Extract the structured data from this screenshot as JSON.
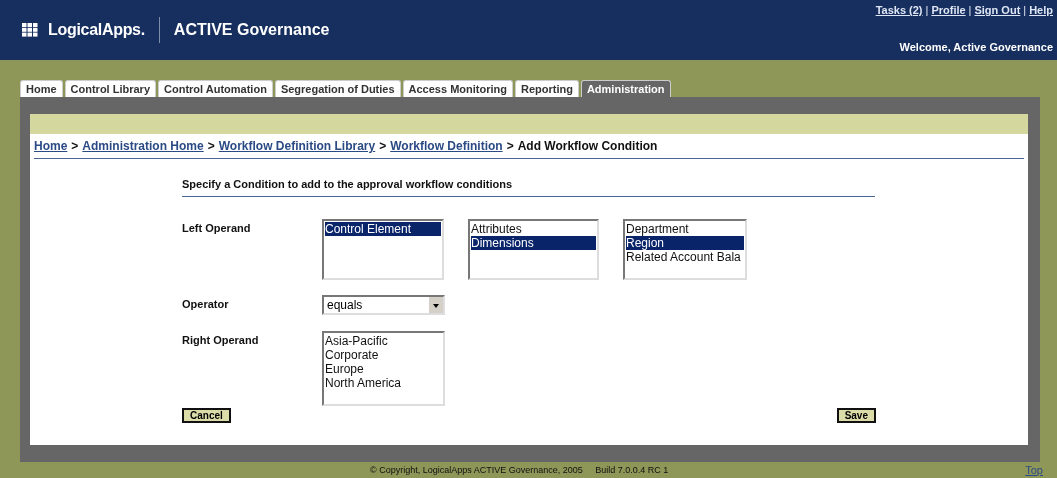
{
  "header": {
    "logo": "LogicalApps.",
    "product": "ACTIVE Governance",
    "links": [
      {
        "label": "Tasks (2)"
      },
      {
        "label": "Profile"
      },
      {
        "label": "Sign Out"
      },
      {
        "label": "Help"
      }
    ],
    "link_separator": "|",
    "welcome": "Welcome, Active Governance"
  },
  "tabs": [
    {
      "label": "Home",
      "selected": false
    },
    {
      "label": "Control Library",
      "selected": false
    },
    {
      "label": "Control Automation",
      "selected": false
    },
    {
      "label": "Segregation of Duties",
      "selected": false
    },
    {
      "label": "Access Monitoring",
      "selected": false
    },
    {
      "label": "Reporting",
      "selected": false
    },
    {
      "label": "Administration",
      "selected": true
    }
  ],
  "breadcrumb": {
    "separator": ">",
    "items": [
      {
        "label": "Home",
        "kind": "link"
      },
      {
        "label": "Administration Home",
        "kind": "link"
      },
      {
        "label": "Workflow Definition Library",
        "kind": "link"
      },
      {
        "label": "Workflow Definition",
        "kind": "link"
      },
      {
        "label": "Add Workflow Condition",
        "kind": "current"
      }
    ]
  },
  "form": {
    "instruction": "Specify a Condition to add to the approval workflow conditions",
    "fields": [
      {
        "label": "Left Operand",
        "kind": "listboxes",
        "lists": [
          {
            "options": [
              {
                "label": "Control Element",
                "selected": true
              }
            ]
          },
          {
            "options": [
              {
                "label": "Attributes",
                "selected": false
              },
              {
                "label": "Dimensions",
                "selected": true
              }
            ]
          },
          {
            "options": [
              {
                "label": "Department",
                "selected": false
              },
              {
                "label": "Region",
                "selected": true
              },
              {
                "label": "Related Account Bala",
                "selected": false
              }
            ]
          }
        ]
      },
      {
        "label": "Operator",
        "kind": "dropdown",
        "value": "equals"
      },
      {
        "label": "Right Operand",
        "kind": "listboxes",
        "lists": [
          {
            "options": [
              {
                "label": "Asia-Pacific",
                "selected": false
              },
              {
                "label": "Corporate",
                "selected": false
              },
              {
                "label": "Europe",
                "selected": false
              },
              {
                "label": "North America",
                "selected": false
              }
            ]
          }
        ]
      }
    ],
    "buttons": {
      "cancel": "Cancel",
      "save": "Save"
    }
  },
  "footer": {
    "copyright": "© Copyright, LogicalApps ACTIVE Governance, 2005",
    "build": "Build 7.0.0.4 RC 1",
    "top": "Top"
  }
}
